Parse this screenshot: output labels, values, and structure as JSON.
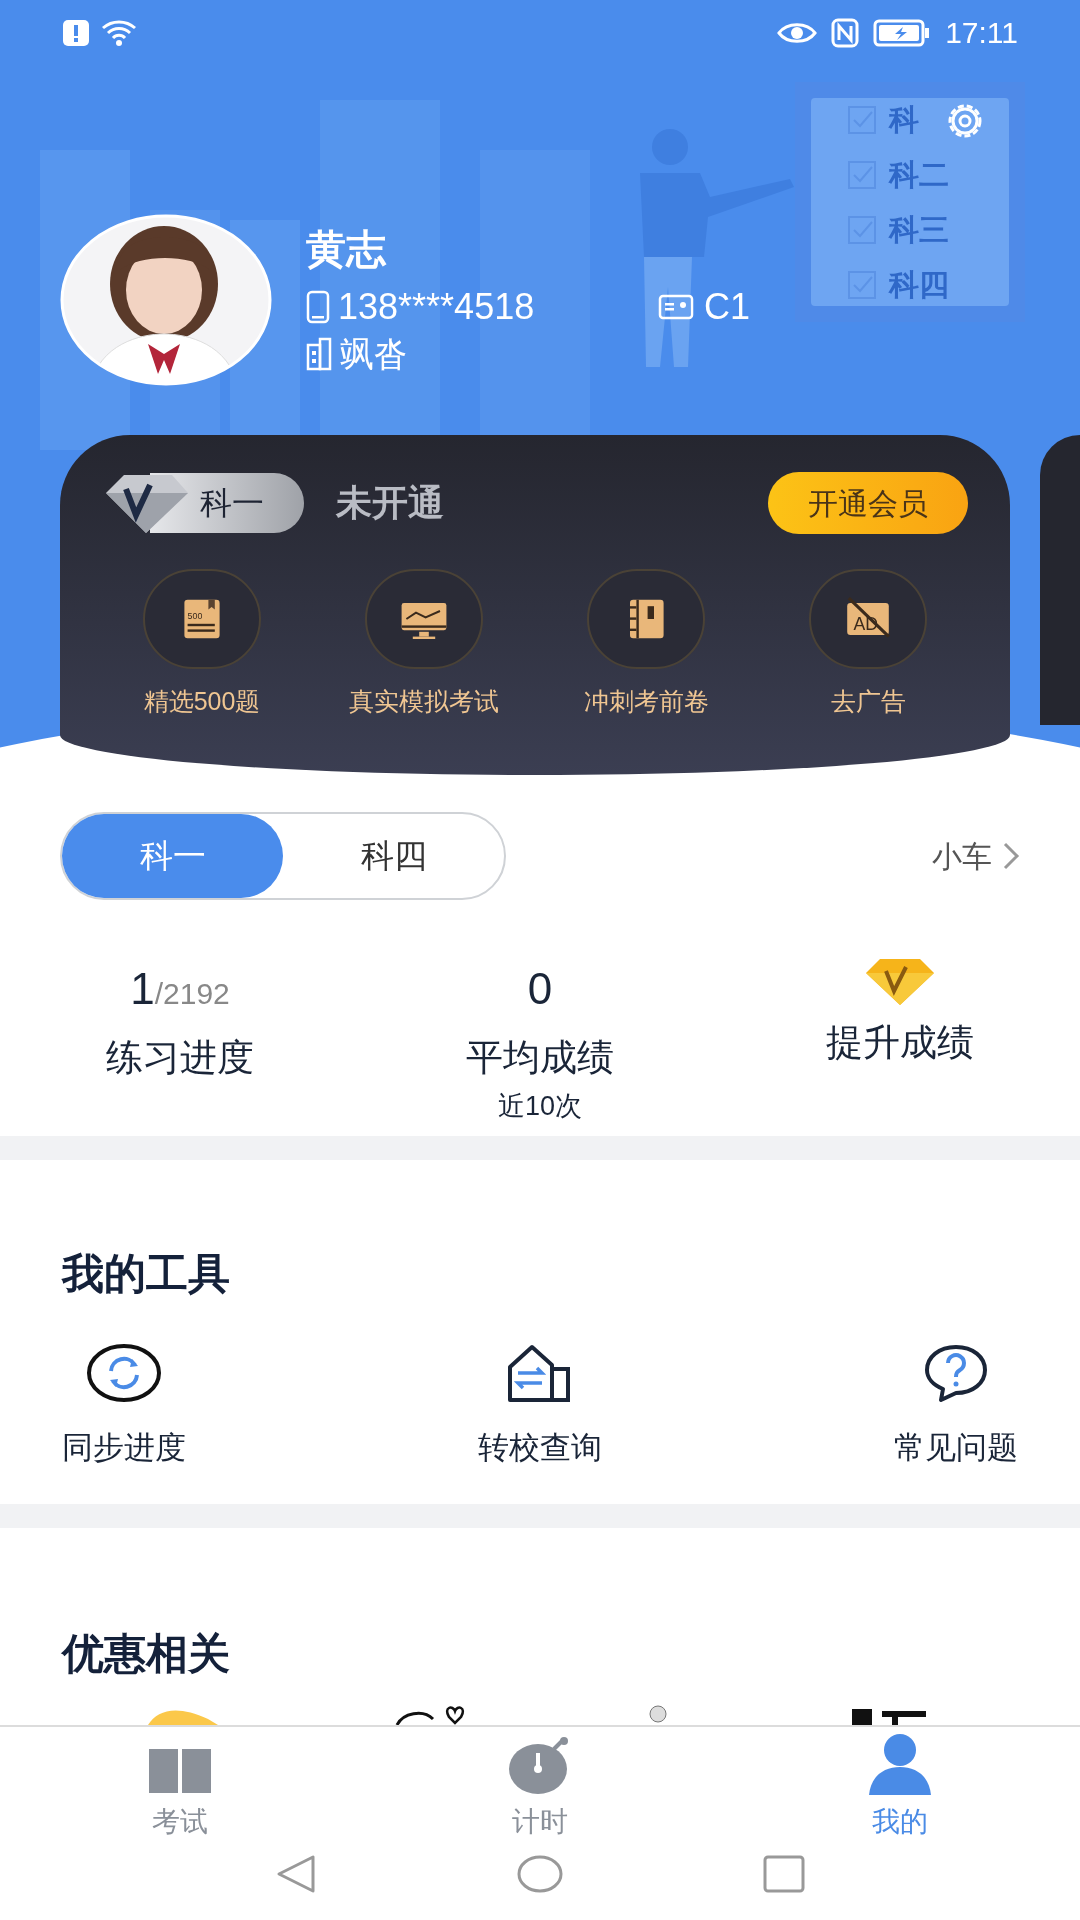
{
  "status_bar": {
    "time": "17:11"
  },
  "illustration": {
    "labels": [
      "科",
      "科二",
      "科三",
      "科四"
    ]
  },
  "profile": {
    "name": "黄志",
    "phone": "138****4518",
    "license": "C1",
    "school": "飒沓"
  },
  "vip_card": {
    "badge": "科一",
    "status": "未开通",
    "button": "开通会员",
    "features": [
      {
        "kind": "book",
        "icon_text": "500",
        "label": "精选500题"
      },
      {
        "kind": "monitor",
        "label": "真实模拟考试"
      },
      {
        "kind": "notebook",
        "label": "冲刺考前卷"
      },
      {
        "kind": "no-ads",
        "icon_text": "AD",
        "label": "去广告"
      }
    ]
  },
  "subject_tabs": [
    {
      "label": "科一",
      "selected": true
    },
    {
      "label": "科四",
      "selected": false
    }
  ],
  "vehicle": "小车",
  "stats": [
    {
      "kind": "progress",
      "value": "1",
      "total": "/2192",
      "label": "练习进度"
    },
    {
      "kind": "score",
      "value": "0",
      "label": "平均成绩",
      "note": "近10次"
    },
    {
      "kind": "vip",
      "label": "提升成绩"
    }
  ],
  "tools": {
    "title": "我的工具",
    "items": [
      {
        "kind": "sync",
        "label": "同步进度"
      },
      {
        "kind": "transfer",
        "label": "转校查询"
      },
      {
        "kind": "faq",
        "label": "常见问题"
      }
    ]
  },
  "offers": {
    "title": "优惠相关"
  },
  "bottom_nav": [
    {
      "kind": "exam",
      "label": "考试",
      "selected": false
    },
    {
      "kind": "timer",
      "label": "计时",
      "selected": false
    },
    {
      "kind": "me",
      "label": "我的",
      "selected": true
    }
  ]
}
